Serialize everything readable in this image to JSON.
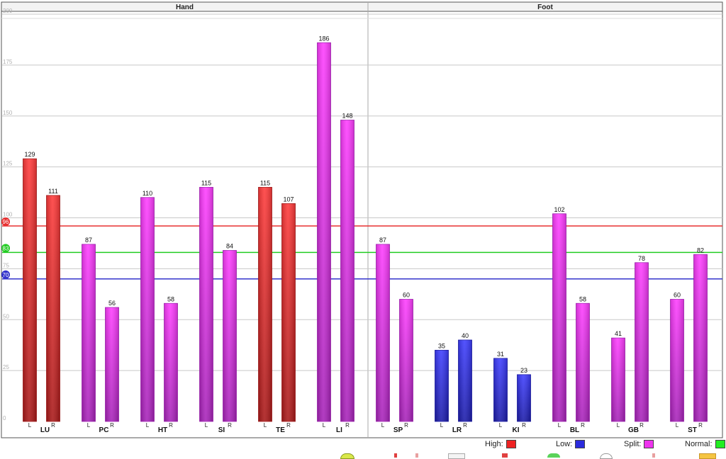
{
  "chart_data": {
    "type": "bar",
    "panels": [
      {
        "title": "Hand",
        "groups": [
          "LU",
          "PC",
          "HT",
          "SI",
          "TE",
          "LI"
        ]
      },
      {
        "title": "Foot",
        "groups": [
          "SP",
          "LR",
          "KI",
          "BL",
          "GB",
          "ST"
        ]
      }
    ],
    "side_labels": [
      "L",
      "R"
    ],
    "bars": [
      {
        "group": "LU",
        "side": "L",
        "value": 129,
        "level": "high"
      },
      {
        "group": "LU",
        "side": "R",
        "value": 111,
        "level": "high"
      },
      {
        "group": "PC",
        "side": "L",
        "value": 87,
        "level": "split"
      },
      {
        "group": "PC",
        "side": "R",
        "value": 56,
        "level": "split"
      },
      {
        "group": "HT",
        "side": "L",
        "value": 110,
        "level": "split"
      },
      {
        "group": "HT",
        "side": "R",
        "value": 58,
        "level": "split"
      },
      {
        "group": "SI",
        "side": "L",
        "value": 115,
        "level": "split"
      },
      {
        "group": "SI",
        "side": "R",
        "value": 84,
        "level": "split"
      },
      {
        "group": "TE",
        "side": "L",
        "value": 115,
        "level": "high"
      },
      {
        "group": "TE",
        "side": "R",
        "value": 107,
        "level": "high"
      },
      {
        "group": "LI",
        "side": "L",
        "value": 186,
        "level": "split"
      },
      {
        "group": "LI",
        "side": "R",
        "value": 148,
        "level": "split"
      },
      {
        "group": "SP",
        "side": "L",
        "value": 87,
        "level": "split"
      },
      {
        "group": "SP",
        "side": "R",
        "value": 60,
        "level": "split"
      },
      {
        "group": "LR",
        "side": "L",
        "value": 35,
        "level": "low"
      },
      {
        "group": "LR",
        "side": "R",
        "value": 40,
        "level": "low"
      },
      {
        "group": "KI",
        "side": "L",
        "value": 31,
        "level": "low"
      },
      {
        "group": "KI",
        "side": "R",
        "value": 23,
        "level": "low"
      },
      {
        "group": "BL",
        "side": "L",
        "value": 102,
        "level": "split"
      },
      {
        "group": "BL",
        "side": "R",
        "value": 58,
        "level": "split"
      },
      {
        "group": "GB",
        "side": "L",
        "value": 41,
        "level": "split"
      },
      {
        "group": "GB",
        "side": "R",
        "value": 78,
        "level": "split"
      },
      {
        "group": "ST",
        "side": "L",
        "value": 60,
        "level": "split"
      },
      {
        "group": "ST",
        "side": "R",
        "value": 82,
        "level": "split"
      }
    ],
    "y_ticks": [
      0,
      25,
      50,
      75,
      100,
      125,
      150,
      175,
      200
    ],
    "ylim": [
      0,
      200
    ],
    "grid": true,
    "reference_lines": [
      {
        "value": 96,
        "color": "#e83030",
        "label": "96"
      },
      {
        "value": 83,
        "color": "#22cc22",
        "label": "83"
      },
      {
        "value": 70,
        "color": "#3333cc",
        "label": "70"
      }
    ],
    "legend": {
      "placement": "bottom-right",
      "entries": [
        {
          "key": "high",
          "label": "High:",
          "color": "#ee2222"
        },
        {
          "key": "low",
          "label": "Low:",
          "color": "#2b2bdd"
        },
        {
          "key": "split",
          "label": "Split:",
          "color": "#ee33ee"
        },
        {
          "key": "normal",
          "label": "Normal:",
          "color": "#22ee22"
        }
      ]
    },
    "level_colors": {
      "high": {
        "top": "#ff3a3a",
        "bottom": "#a81818"
      },
      "low": {
        "top": "#3d3dff",
        "bottom": "#1a1aa8"
      },
      "split": {
        "top": "#ff3cff",
        "bottom": "#a622b8"
      }
    }
  }
}
